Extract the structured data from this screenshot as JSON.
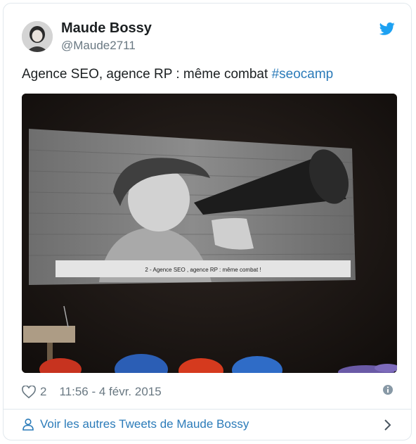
{
  "author": {
    "name": "Maude Bossy",
    "handle": "@Maude2711"
  },
  "tweet": {
    "text": "Agence SEO, agence RP : même combat ",
    "hashtag": "#seocamp"
  },
  "media": {
    "slide_caption": "2 - Agence SEO , agence RP : même combat !"
  },
  "meta": {
    "like_count": "2",
    "timestamp": "11:56 - 4 févr. 2015"
  },
  "footer": {
    "more_link": "Voir les autres Tweets de Maude Bossy"
  },
  "colors": {
    "link": "#2b7bb9",
    "muted": "#697882",
    "twitter_blue": "#1da1f2"
  },
  "icons": [
    "twitter-bird-icon",
    "heart-icon",
    "info-icon",
    "person-icon",
    "chevron-right-icon"
  ]
}
